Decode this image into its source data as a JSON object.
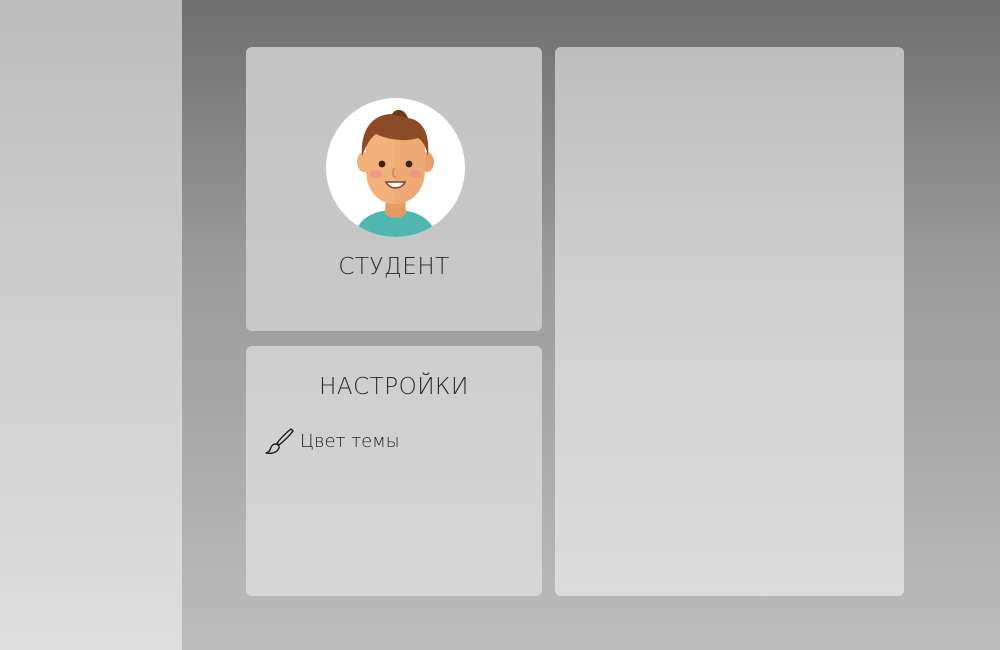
{
  "profile": {
    "avatar_icon": "student-avatar-icon",
    "role": "СТУДЕНТ"
  },
  "settings": {
    "title": "НАСТРОЙКИ",
    "items": [
      {
        "icon": "paint-brush-icon",
        "label": "Цвет темы"
      }
    ]
  },
  "colors": {
    "background_top": "#6f6f6f",
    "sidebar": "#cfcfcf",
    "card": "#c8c8c8",
    "avatar_bg": "#ffffff",
    "shirt": "#4fb6b0",
    "hair": "#8a4b26",
    "skin": "#f2b07a"
  }
}
